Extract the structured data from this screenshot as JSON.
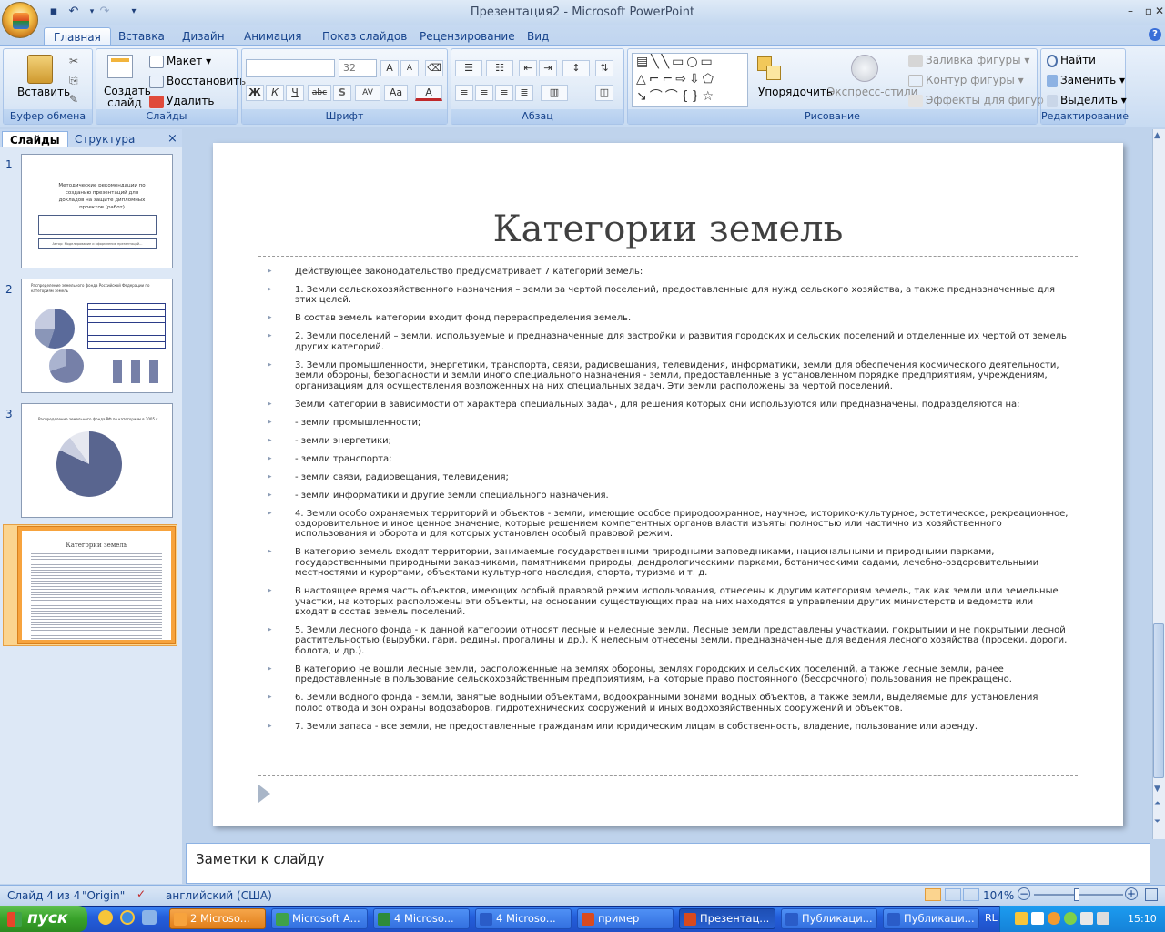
{
  "window": {
    "title": "Презентация2 - Microsoft PowerPoint",
    "min": "–",
    "max": "▫",
    "close": "✕",
    "help": "?"
  },
  "ribbon_tabs": [
    "Главная",
    "Вставка",
    "Дизайн",
    "Анимация",
    "Показ слайдов",
    "Рецензирование",
    "Вид"
  ],
  "groups": {
    "clipboard": {
      "label": "Буфер обмена",
      "paste": "Вставить"
    },
    "slides": {
      "label": "Слайды",
      "new_slide": "Создать слайд",
      "layout": "Макет",
      "reset": "Восстановить",
      "delete": "Удалить"
    },
    "font": {
      "label": "Шрифт",
      "font_name": "",
      "font_size": "32",
      "bold": "Ж",
      "italic": "К",
      "underline": "Ч",
      "strike": "abc",
      "shadow": "S",
      "spacing": "AV",
      "case": "Aa",
      "color": "A"
    },
    "paragraph": {
      "label": "Абзац"
    },
    "drawing": {
      "label": "Рисование",
      "arrange": "Упорядочить",
      "quick_styles": "Экспресс-стили",
      "fill": "Заливка фигуры",
      "outline": "Контур фигуры",
      "effects": "Эффекты для фигур"
    },
    "editing": {
      "label": "Редактирование",
      "find": "Найти",
      "replace": "Заменить",
      "select": "Выделить"
    }
  },
  "left_pane": {
    "tab_slides": "Слайды",
    "tab_outline": "Структура",
    "close": "×",
    "thumb1_lines": [
      "Методические рекомендации по",
      "созданию презентаций для",
      "докладов на защите дипломных",
      "проектов (работ)"
    ],
    "thumb1_caption": "Автор: Моделирование и оформление презентаций…",
    "thumb2_title": "Распределение земельного фонда Российской Федерации по категориям земель",
    "thumb3_title": "Распределение земельного фонда РФ по категориям в 2005 г.",
    "thumb4_title": "Категории земель"
  },
  "slide": {
    "title": "Категории земель",
    "bullets": [
      "Действующее законодательство предусматривает 7 категорий земель:",
      "1. Земли сельскохозяйственного назначения – земли за чертой поселений, предоставленные для нужд сельского хозяйства, а также предназначенные для этих целей.",
      "В состав земель категории входит фонд перераспределения земель.",
      "2. Земли поселений – земли, используемые и предназначенные для застройки и развития городских и сельских поселений и отделенные их чертой от земель других категорий.",
      "3. Земли промышленности, энергетики, транспорта, связи, радиовещания, телевидения, информатики, земли для обеспечения космического деятельности, земли обороны, безопасности и земли иного специального назначения - земли, предоставленные в установленном порядке предприятиям, учреждениям, организациям для осуществления возложенных на них специальных задач. Эти земли расположены за чертой поселений.",
      "Земли категории в зависимости от характера специальных задач, для решения которых они используются или предназначены, подразделяются на:",
      "- земли промышленности;",
      "- земли энергетики;",
      "- земли транспорта;",
      "- земли связи, радиовещания, телевидения;",
      "- земли информатики и другие земли специального назначения.",
      "4. Земли особо охраняемых территорий и объектов - земли, имеющие особое природоохранное, научное, историко-культурное, эстетическое, рекреационное, оздоровительное и иное ценное значение, которые решением компетентных органов власти изъяты полностью или частично из хозяйственного использования и оборота и для которых установлен особый правовой режим.",
      "В категорию земель входят территории, занимаемые государственными природными заповедниками, национальными и природными парками, государственными природными заказниками, памятниками природы, дендрологическими парками, ботаническими садами, лечебно-оздоровительными местностями и курортами, объектами культурного наследия, спорта, туризма и т. д.",
      "В настоящее время часть объектов, имеющих особый правовой режим использования, отнесены к другим категориям земель, так как земли или земельные участки, на которых расположены эти объекты, на основании существующих прав на них находятся в управлении других министерств и ведомств или входят в состав земель поселений.",
      "5. Земли лесного фонда - к данной категории относят лесные и нелесные земли. Лесные земли представлены участками, покрытыми и не покрытыми лесной растительностью (вырубки, гари, редины, прогалины и др.). К нелесным отнесены земли, предназначенные для ведения лесного хозяйства (просеки, дороги, болота, и др.).",
      "В категорию не вошли лесные земли, расположенные на землях обороны, землях городских и сельских поселений, а также лесные земли, ранее предоставленные в пользование сельскохозяйственным предприятиям, на которые право постоянного (бессрочного) пользования не прекращено.",
      "6. Земли водного фонда - земли, занятые водными объектами, водоохранными зонами водных объектов, а также земли, выделяемые для установления полос отвода и зон охраны водозаборов, гидротехнических сооружений и иных водохозяйственных сооружений и объектов.",
      "7. Земли запаса - все земли, не предоставленные гражданам или юридическим лицам в собственность, владение, пользование или аренду."
    ]
  },
  "notes_placeholder": "Заметки к слайду",
  "status": {
    "slide": "Слайд 4 из 4",
    "theme": "\"Origin\"",
    "language": "английский (США)",
    "zoom": "104%"
  },
  "taskbar": {
    "start": "пуск",
    "tasks": [
      "2 Microso...",
      "Microsoft A...",
      "4 Microso...",
      "4 Microso...",
      "пример",
      "Презентац...",
      "Публикаци...",
      "Публикаци..."
    ],
    "lang": "RL",
    "clock": "15:10"
  },
  "colors": {
    "accent": "#15428b",
    "selected_thumb": "#f7a33d",
    "taskbar": "#245edb",
    "start": "#38a22a"
  }
}
